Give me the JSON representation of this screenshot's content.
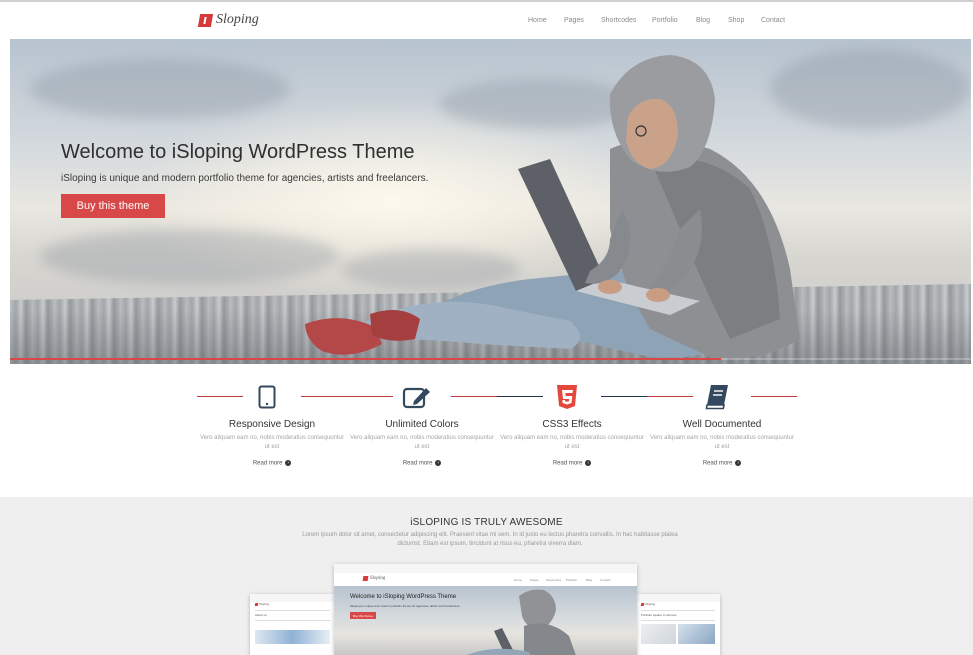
{
  "brand": {
    "name": "Sloping",
    "accent": "#d94848"
  },
  "nav": {
    "items": [
      "Home",
      "Pages",
      "Shortcodes",
      "Portfolio",
      "Blog",
      "Shop",
      "Contact"
    ]
  },
  "hero": {
    "title": "Welcome to iSloping WordPress Theme",
    "subtitle": "iSloping is unique and modern portfolio theme for agencies, artists and freelancers.",
    "button": "Buy this theme",
    "progress": 0.74
  },
  "features": [
    {
      "icon": "tablet-icon",
      "title": "Responsive Design",
      "desc": "Vero aliquam eam no, nobis moderatius consequuntur ut est",
      "more": "Read more",
      "line_color": "#c0393b"
    },
    {
      "icon": "edit-icon",
      "title": "Unlimited Colors",
      "desc": "Vero aliquam eam no, nobis moderatius consequuntur ut est",
      "more": "Read more",
      "line_color": "#c0393b"
    },
    {
      "icon": "css3-icon",
      "title": "CSS3 Effects",
      "desc": "Vero aliquam eam no, nobis moderatius consequuntur ut est",
      "more": "Read more",
      "line_color": "#1f3550"
    },
    {
      "icon": "book-icon",
      "title": "Well Documented",
      "desc": "Vero aliquam eam no, nobis moderatius consequuntur ut est",
      "more": "Read more",
      "line_color": "#c0393b"
    }
  ],
  "awesome": {
    "title": "iSLOPING IS TRULY AWESOME",
    "text": "Lorem ipsum dolor sit amet, consectetur adipiscing elit. Praesent vitae mi sem. In id justo eu lectus pharetra convallis. In hac habitasse platea dictumst. Etiam est ipsum, tincidunt at risus eu, pharetra viverra diam."
  },
  "preview": {
    "center": {
      "logo": "Sloping",
      "nav": [
        "Home",
        "Pages",
        "Shortcodes",
        "Portfolio",
        "Blog",
        "Contact"
      ],
      "hero_title": "Welcome to iSloping WordPress Theme",
      "hero_sub": "iSloping is unique and modern portfolio theme for agencies, artists and freelancers.",
      "hero_button": "Buy this theme"
    },
    "left": {
      "logo": "iSloping",
      "heading": "About us"
    },
    "right": {
      "logo": "iSloping",
      "heading": "Portfolio square 4 columns"
    }
  }
}
